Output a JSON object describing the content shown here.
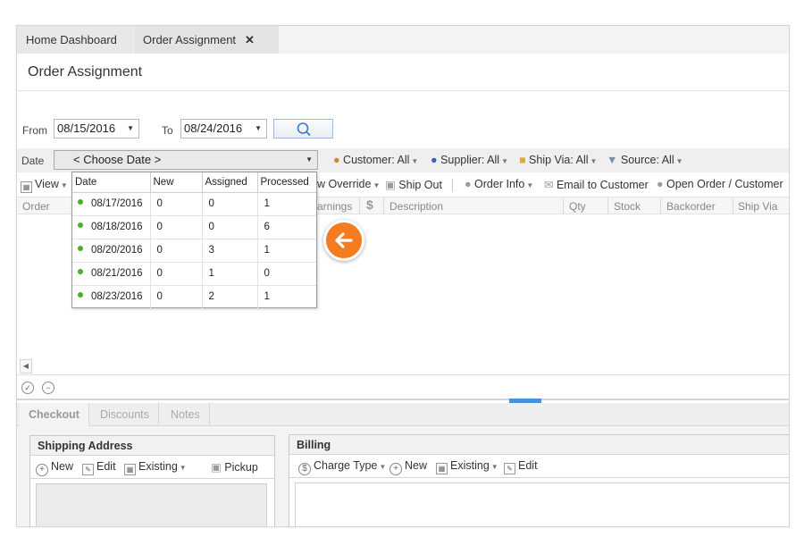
{
  "tabs": {
    "home": "Home Dashboard",
    "active": "Order Assignment",
    "close": "✕"
  },
  "page_title": "Order Assignment",
  "date_range": {
    "from_label": "From",
    "from_value": "08/15/2016",
    "to_label": "To",
    "to_value": "08/24/2016"
  },
  "filters": {
    "date_label": "Date",
    "date_placeholder": "< Choose Date >",
    "customer": "Customer: All",
    "supplier": "Supplier: All",
    "ship_via": "Ship Via: All",
    "source": "Source: All"
  },
  "toolbar": {
    "view": "View",
    "override": "w Override",
    "ship_out": "Ship Out",
    "order_info": "Order Info",
    "email": "Email to Customer",
    "open_order": "Open Order / Customer"
  },
  "grid": {
    "columns": [
      "Order",
      "arnings",
      "Description",
      "Qty",
      "Stock",
      "Backorder",
      "Ship Via"
    ]
  },
  "date_dropdown": {
    "headers": [
      "Date",
      "New",
      "Assigned",
      "Processed"
    ],
    "rows": [
      {
        "date": "08/17/2016",
        "new": "0",
        "assigned": "0",
        "processed": "1"
      },
      {
        "date": "08/18/2016",
        "new": "0",
        "assigned": "0",
        "processed": "6"
      },
      {
        "date": "08/20/2016",
        "new": "0",
        "assigned": "3",
        "processed": "1"
      },
      {
        "date": "08/21/2016",
        "new": "0",
        "assigned": "1",
        "processed": "0"
      },
      {
        "date": "08/23/2016",
        "new": "0",
        "assigned": "2",
        "processed": "1"
      }
    ]
  },
  "subtabs": [
    "Checkout",
    "Discounts",
    "Notes"
  ],
  "shipping": {
    "title": "Shipping Address",
    "new": "New",
    "edit": "Edit",
    "existing": "Existing",
    "pickup": "Pickup"
  },
  "billing": {
    "title": "Billing",
    "charge_type": "Charge Type",
    "new": "New",
    "existing": "Existing",
    "edit": "Edit"
  },
  "colors": {
    "accent_orange": "#f47b20",
    "status_green": "#4caf2a",
    "divider_blue": "#4a90d9"
  }
}
